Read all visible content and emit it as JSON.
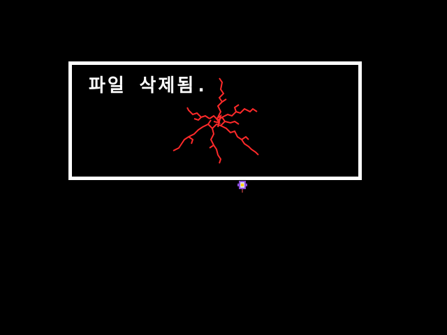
{
  "dialog": {
    "text": "파일 삭제됨."
  },
  "colors": {
    "background": "#000000",
    "box_border": "#ffffff",
    "text": "#ffffff",
    "crack": "#ff2a2a"
  },
  "icons": {
    "crack": "shattered-crack-icon",
    "character": "flower-character-icon"
  }
}
